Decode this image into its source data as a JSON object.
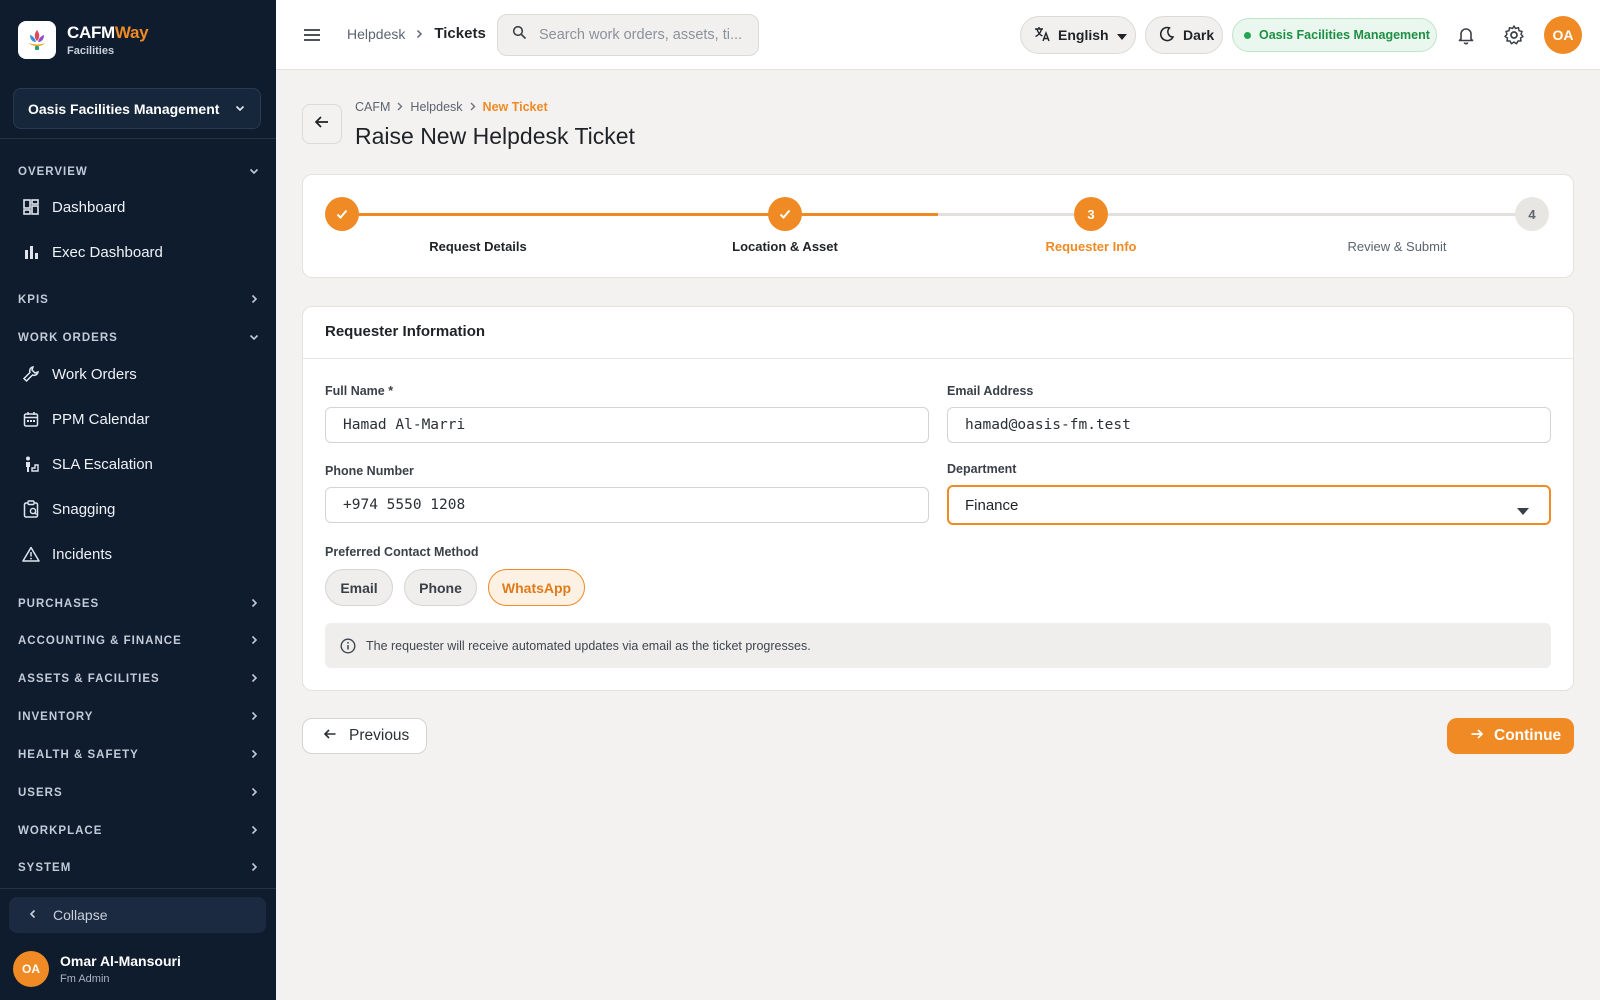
{
  "brand": {
    "name_part1": "CAFM",
    "name_part2": "Way",
    "subtitle": "Facilities"
  },
  "org_selector": {
    "value": "Oasis Facilities Management"
  },
  "sidebar": {
    "sections": {
      "overview": "OVERVIEW",
      "kpis": "KPIS",
      "work_orders": "WORK ORDERS",
      "purchases": "PURCHASES",
      "accounting": "ACCOUNTING & FINANCE",
      "assets": "ASSETS & FACILITIES",
      "inventory": "INVENTORY",
      "health_safety": "HEALTH & SAFETY",
      "users": "USERS",
      "workplace": "WORKPLACE",
      "system": "SYSTEM"
    },
    "items": {
      "dashboard": "Dashboard",
      "exec_dashboard": "Exec Dashboard",
      "work_orders": "Work Orders",
      "ppm_calendar": "PPM Calendar",
      "sla_escalation": "SLA Escalation",
      "snagging": "Snagging",
      "incidents": "Incidents"
    },
    "collapse_label": "Collapse",
    "user": {
      "initials": "OA",
      "name": "Omar Al-Mansouri",
      "role": "Fm Admin"
    }
  },
  "topbar": {
    "breadcrumb_parent": "Helpdesk",
    "breadcrumb_current": "Tickets",
    "search_placeholder": "Search work orders, assets, ti...",
    "language": "English",
    "theme_label": "Dark",
    "org_badge": "Oasis Facilities Management",
    "avatar_initials": "OA"
  },
  "page": {
    "breadcrumb": [
      "CAFM",
      "Helpdesk",
      "New Ticket"
    ],
    "title": "Raise New Helpdesk Ticket"
  },
  "stepper": {
    "current_step": 3,
    "steps": [
      {
        "number": "1",
        "label": "Request Details",
        "status": "completed"
      },
      {
        "number": "2",
        "label": "Location & Asset",
        "status": "completed"
      },
      {
        "number": "3",
        "label": "Requester Info",
        "status": "current"
      },
      {
        "number": "4",
        "label": "Review & Submit",
        "status": "upcoming"
      }
    ]
  },
  "form": {
    "section_title": "Requester Information",
    "full_name": {
      "label": "Full Name *",
      "value": "Hamad Al-Marri"
    },
    "email": {
      "label": "Email Address",
      "value": "hamad@oasis-fm.test"
    },
    "phone": {
      "label": "Phone Number",
      "value": "+974 5550 1208"
    },
    "department": {
      "label": "Department",
      "value": "Finance"
    },
    "contact_method": {
      "label": "Preferred Contact Method",
      "options": [
        "Email",
        "Phone",
        "WhatsApp"
      ],
      "selected": "WhatsApp"
    },
    "info_note": "The requester will receive automated updates via email as the ticket progresses."
  },
  "actions": {
    "previous": "Previous",
    "continue": "Continue"
  },
  "colors": {
    "accent": "#f08a24",
    "sidebar_bg": "#0f1c2e",
    "success": "#23a455"
  }
}
